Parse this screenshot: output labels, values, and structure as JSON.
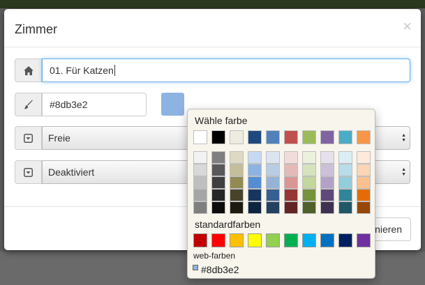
{
  "dialog": {
    "title": "Zimmer",
    "close_label": "×",
    "name_field": {
      "value": "01. Für Katzen",
      "icon": "home-icon"
    },
    "color_field": {
      "value": "#8db3e2",
      "icon": "brush-icon",
      "swatch_color": "#8db3e2"
    },
    "status_select": {
      "value": "Freie",
      "icon": "caret-square-down-icon"
    },
    "active_select": {
      "value": "Deaktiviert",
      "icon": "caret-square-down-icon"
    },
    "footer_button_label": "nieren"
  },
  "color_palette": {
    "title": "Wähle farbe",
    "theme_colors": [
      "#ffffff",
      "#000000",
      "#eeece1",
      "#1f497d",
      "#4f81bd",
      "#c0504d",
      "#9bbb59",
      "#8064a2",
      "#4bacc6",
      "#f79646"
    ],
    "shade_columns": [
      [
        "#f2f2f2",
        "#d8d8d8",
        "#bfbfbf",
        "#a5a5a5",
        "#7f7f7f"
      ],
      [
        "#7f7f7f",
        "#595959",
        "#3f3f3f",
        "#262626",
        "#0c0c0c"
      ],
      [
        "#ddd9c3",
        "#c4bd97",
        "#938953",
        "#494429",
        "#1d1b10"
      ],
      [
        "#c6d9f0",
        "#8db3e2",
        "#548dd4",
        "#17365d",
        "#0f243e"
      ],
      [
        "#dbe5f1",
        "#b8cce4",
        "#95b3d7",
        "#366092",
        "#244061"
      ],
      [
        "#f2dcdb",
        "#e5b9b7",
        "#d99694",
        "#953734",
        "#632423"
      ],
      [
        "#ebf1dd",
        "#d7e3bc",
        "#c3d69b",
        "#76923c",
        "#4f6128"
      ],
      [
        "#e5e0ec",
        "#ccc1d9",
        "#b2a2c7",
        "#5f497a",
        "#3f3151"
      ],
      [
        "#dbeef3",
        "#b7dde8",
        "#92cddc",
        "#31859b",
        "#205867"
      ],
      [
        "#fdeada",
        "#fbd5b5",
        "#fac08f",
        "#e36c09",
        "#974806"
      ]
    ],
    "standard_label": "standardfarben",
    "standard_colors": [
      "#c00000",
      "#ff0000",
      "#ffc000",
      "#ffff00",
      "#92d050",
      "#00b050",
      "#00b0f0",
      "#0070c0",
      "#002060",
      "#7030a0"
    ],
    "web_label": "web-farben",
    "current_value": "#8db3e2"
  }
}
